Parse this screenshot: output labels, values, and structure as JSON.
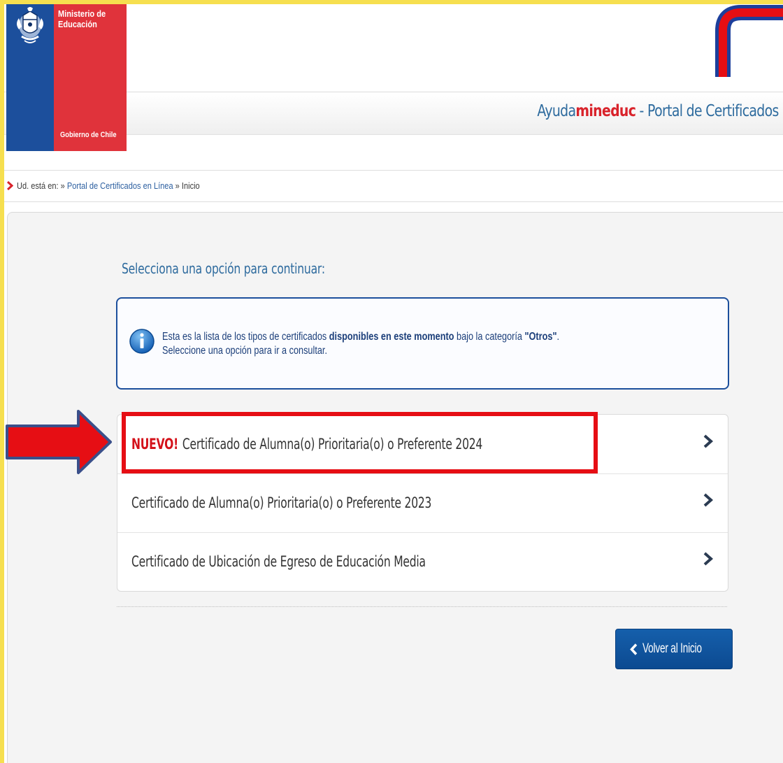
{
  "logo": {
    "line1": "Ministerio de",
    "line2": "Educación",
    "footer": "Gobierno de Chile"
  },
  "header": {
    "brand_prefix": "Ayuda",
    "brand_highlight": "mineduc",
    "title_rest": " - Portal de Certificados e"
  },
  "breadcrumb": {
    "prefix": "Ud. está en: » ",
    "link": "Portal de Certificados en Línea",
    "separator": " » ",
    "current": "Inicio"
  },
  "main": {
    "heading": "Selecciona una opción para continuar:",
    "info": {
      "part1": "Esta es la lista de los tipos de certificados ",
      "bold1": "disponibles en este momento",
      "part2": " bajo la categoría ",
      "bold2": "\"Otros\"",
      "part3": ".",
      "line2": "Seleccione una opción para ir a consultar."
    },
    "options": [
      {
        "badge": "NUEVO!",
        "label": "Certificado de Alumna(o) Prioritaria(o) o Preferente 2024"
      },
      {
        "label": "Certificado de Alumna(o) Prioritaria(o) o Preferente 2023"
      },
      {
        "label": "Certificado de Ubicación de Egreso de Educación Media"
      }
    ],
    "back_button": "Volver al Inicio"
  },
  "colors": {
    "frame": "#f6df4f",
    "primary_blue": "#1c4f9c",
    "accent_red": "#d9232b",
    "annotation_red": "#e60e14"
  },
  "icons": [
    "chile-emblem-icon",
    "info-icon",
    "chevron-right-icon",
    "chevron-left-icon",
    "breadcrumb-chevron-icon",
    "arrow-right-icon"
  ]
}
